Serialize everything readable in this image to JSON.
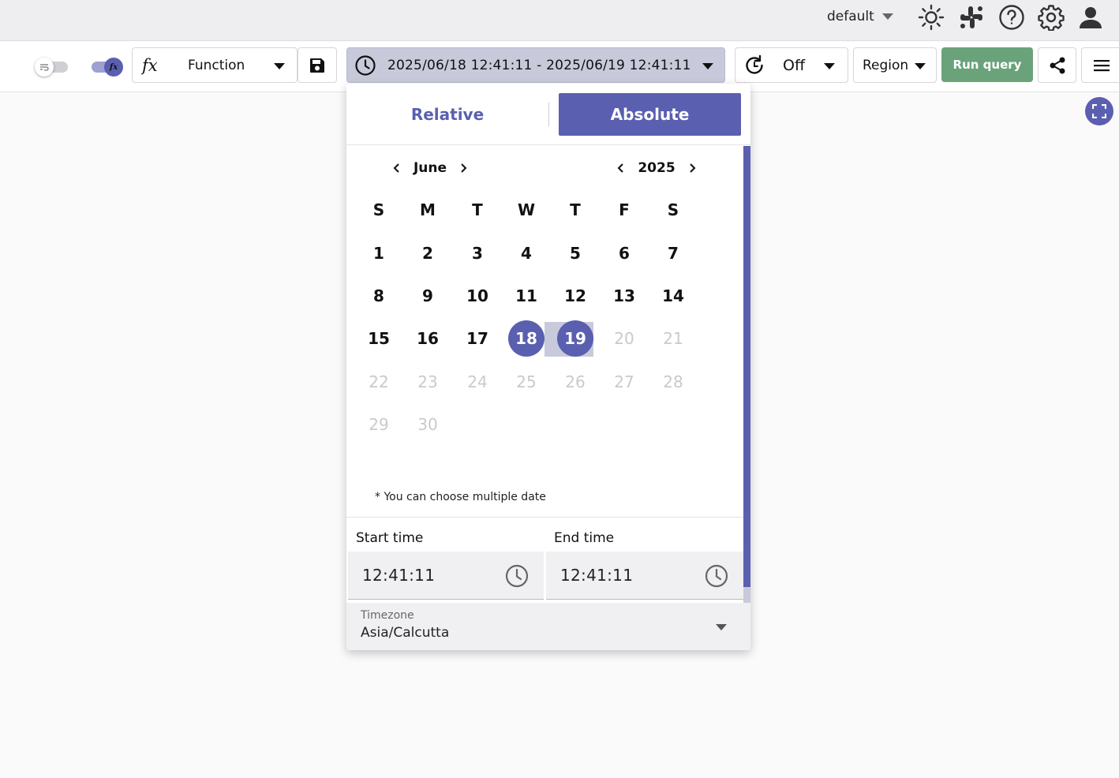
{
  "header": {
    "org_label": "default",
    "icons": [
      "theme-sun-icon",
      "slack-icon",
      "help-icon",
      "settings-gear-icon",
      "user-account-icon"
    ]
  },
  "toolbar": {
    "wrap_toggle_on": false,
    "fn_toggle_on": true,
    "fn_toggle_glyph": "fx",
    "function_glyph": "fx",
    "function_label": "Function",
    "date_range_label": "2025/06/18 12:41:11 - 2025/06/19 12:41:11",
    "refresh_label": "Off",
    "region_label": "Region",
    "run_query_label": "Run query",
    "accent_color": "#5b5fb0",
    "run_color": "#6aa37a"
  },
  "picker": {
    "tab_relative": "Relative",
    "tab_absolute": "Absolute",
    "active_tab": "Absolute",
    "month_label": "June",
    "year_label": "2025",
    "weekdays": [
      "S",
      "M",
      "T",
      "W",
      "T",
      "F",
      "S"
    ],
    "days": [
      "1",
      "2",
      "3",
      "4",
      "5",
      "6",
      "7",
      "8",
      "9",
      "10",
      "11",
      "12",
      "13",
      "14",
      "15",
      "16",
      "17",
      "18",
      "19",
      "20",
      "21",
      "22",
      "23",
      "24",
      "25",
      "26",
      "27",
      "28",
      "29",
      "30"
    ],
    "selected_days": [
      "18",
      "19"
    ],
    "disabled_after": "19",
    "note": "* You can choose multiple date",
    "start_label": "Start time",
    "end_label": "End time",
    "start_time": "12:41:11",
    "end_time": "12:41:11",
    "tz_label": "Timezone",
    "tz_value": "Asia/Calcutta"
  }
}
